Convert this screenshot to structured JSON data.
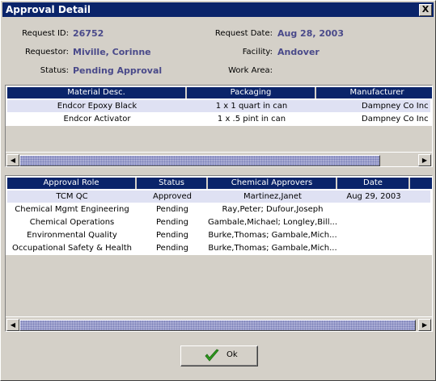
{
  "window": {
    "title": "Approval Detail",
    "close_glyph": "X"
  },
  "details": {
    "request_id": {
      "label": "Request ID:",
      "value": "26752"
    },
    "requestor": {
      "label": "Requestor:",
      "value": "Miville, Corinne"
    },
    "status": {
      "label": "Status:",
      "value": "Pending Approval"
    },
    "request_date": {
      "label": "Request Date:",
      "value": "Aug 28, 2003"
    },
    "facility": {
      "label": "Facility:",
      "value": "Andover"
    },
    "work_area": {
      "label": "Work Area:",
      "value": ""
    }
  },
  "materials": {
    "columns": [
      "Material Desc.",
      "Packaging",
      "Manufacturer"
    ],
    "rows": [
      [
        "Endcor Epoxy Black",
        "1 x 1 quart in can",
        "Dampney Co Inc"
      ],
      [
        "Endcor Activator",
        "1 x .5 pint in can",
        "Dampney Co Inc"
      ]
    ]
  },
  "approvals": {
    "columns": [
      "Approval Role",
      "Status",
      "Chemical Approvers",
      "Date"
    ],
    "rows": [
      [
        "TCM QC",
        "Approved",
        "Martinez,Janet",
        "Aug 29, 2003"
      ],
      [
        "Chemical Mgmt Engineering",
        "Pending",
        "Ray,Peter; Dufour,Joseph",
        ""
      ],
      [
        "Chemical Operations",
        "Pending",
        "Gambale,Michael; Longley,Bill...",
        ""
      ],
      [
        "Environmental Quality",
        "Pending",
        "Burke,Thomas; Gambale,Mich...",
        ""
      ],
      [
        "Occupational Safety & Health",
        "Pending",
        "Burke,Thomas; Gambale,Mich...",
        ""
      ]
    ]
  },
  "ok_button": {
    "label": "Ok",
    "icon": "checkmark-icon"
  },
  "colors": {
    "title_bar": "#0a246a",
    "value_text": "#4a4a8a",
    "header_bg": "#0a246a",
    "selected_row": "#dfe1f3",
    "check_green": "#2e9a1e"
  }
}
